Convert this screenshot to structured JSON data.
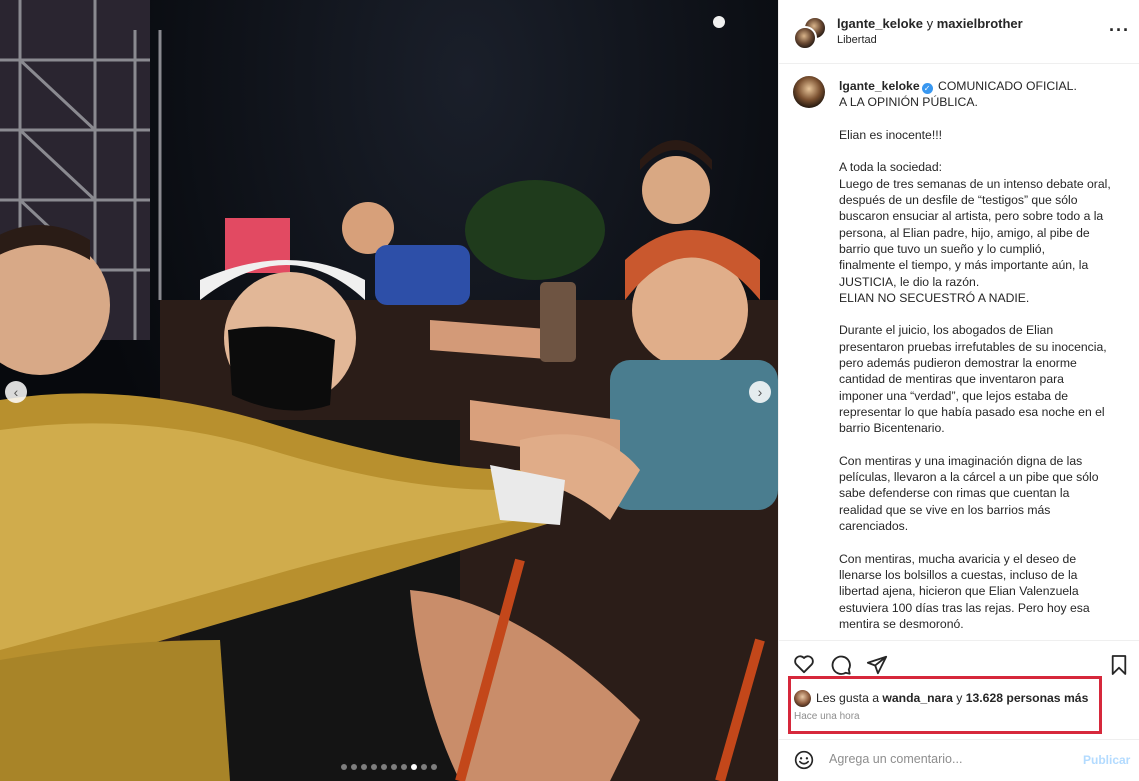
{
  "header": {
    "user1": "lgante_keloke",
    "conj": "y",
    "user2": "maxielbrother",
    "location": "Libertad",
    "more_icon": "more-horizontal-icon"
  },
  "caption": {
    "username": "lgante_keloke",
    "line0": "COMUNICADO OFICIAL.",
    "lines": [
      "A LA OPINIÓN PÚBLICA.",
      "",
      "Elian es inocente!!!",
      "",
      "A toda la sociedad:",
      "Luego de tres semanas de un intenso debate oral,",
      "después de un desfile de “testigos” que sólo",
      "buscaron ensuciar al artista, pero sobre todo a la",
      "persona, al Elian padre, hijo, amigo, al pibe de",
      "barrio que tuvo un sueño y lo cumplió,",
      "finalmente el tiempo, y más importante aún, la",
      "JUSTICIA, le dio la razón.",
      "ELIAN NO SECUESTRÓ A NADIE.",
      "",
      "Durante el juicio, los abogados de Elian",
      "presentaron pruebas irrefutables de su inocencia,",
      "pero además pudieron demostrar la enorme",
      "cantidad de mentiras que inventaron para",
      "imponer una “verdad”, que lejos estaba de",
      "representar lo que había pasado esa noche en el",
      "barrio Bicentenario.",
      "",
      "Con mentiras y una imaginación digna de las",
      "películas, llevaron a la cárcel a un pibe que sólo",
      "sabe defenderse con rimas que cuentan la",
      "realidad que se vive en los barrios más",
      "carenciados.",
      "",
      "Con mentiras, mucha avaricia y el deseo de",
      "llenarse los bolsillos a cuestas, incluso de la",
      "libertad ajena, hicieron que Elian Valenzuela",
      "estuviera 100 días tras las rejas. Pero hoy esa",
      "mentira se desmoronó."
    ]
  },
  "likes": {
    "prefix": "Les gusta a",
    "user": "wanda_nara",
    "conj": "y",
    "count": "13.628 personas más"
  },
  "time": "Hace una hora",
  "comment": {
    "placeholder": "Agrega un comentario...",
    "publish": "Publicar"
  },
  "carousel": {
    "total": 10,
    "active_index": 7
  },
  "colors": {
    "highlight": "#d6283b",
    "verified": "#3897f0",
    "publish": "#b3dbff"
  }
}
